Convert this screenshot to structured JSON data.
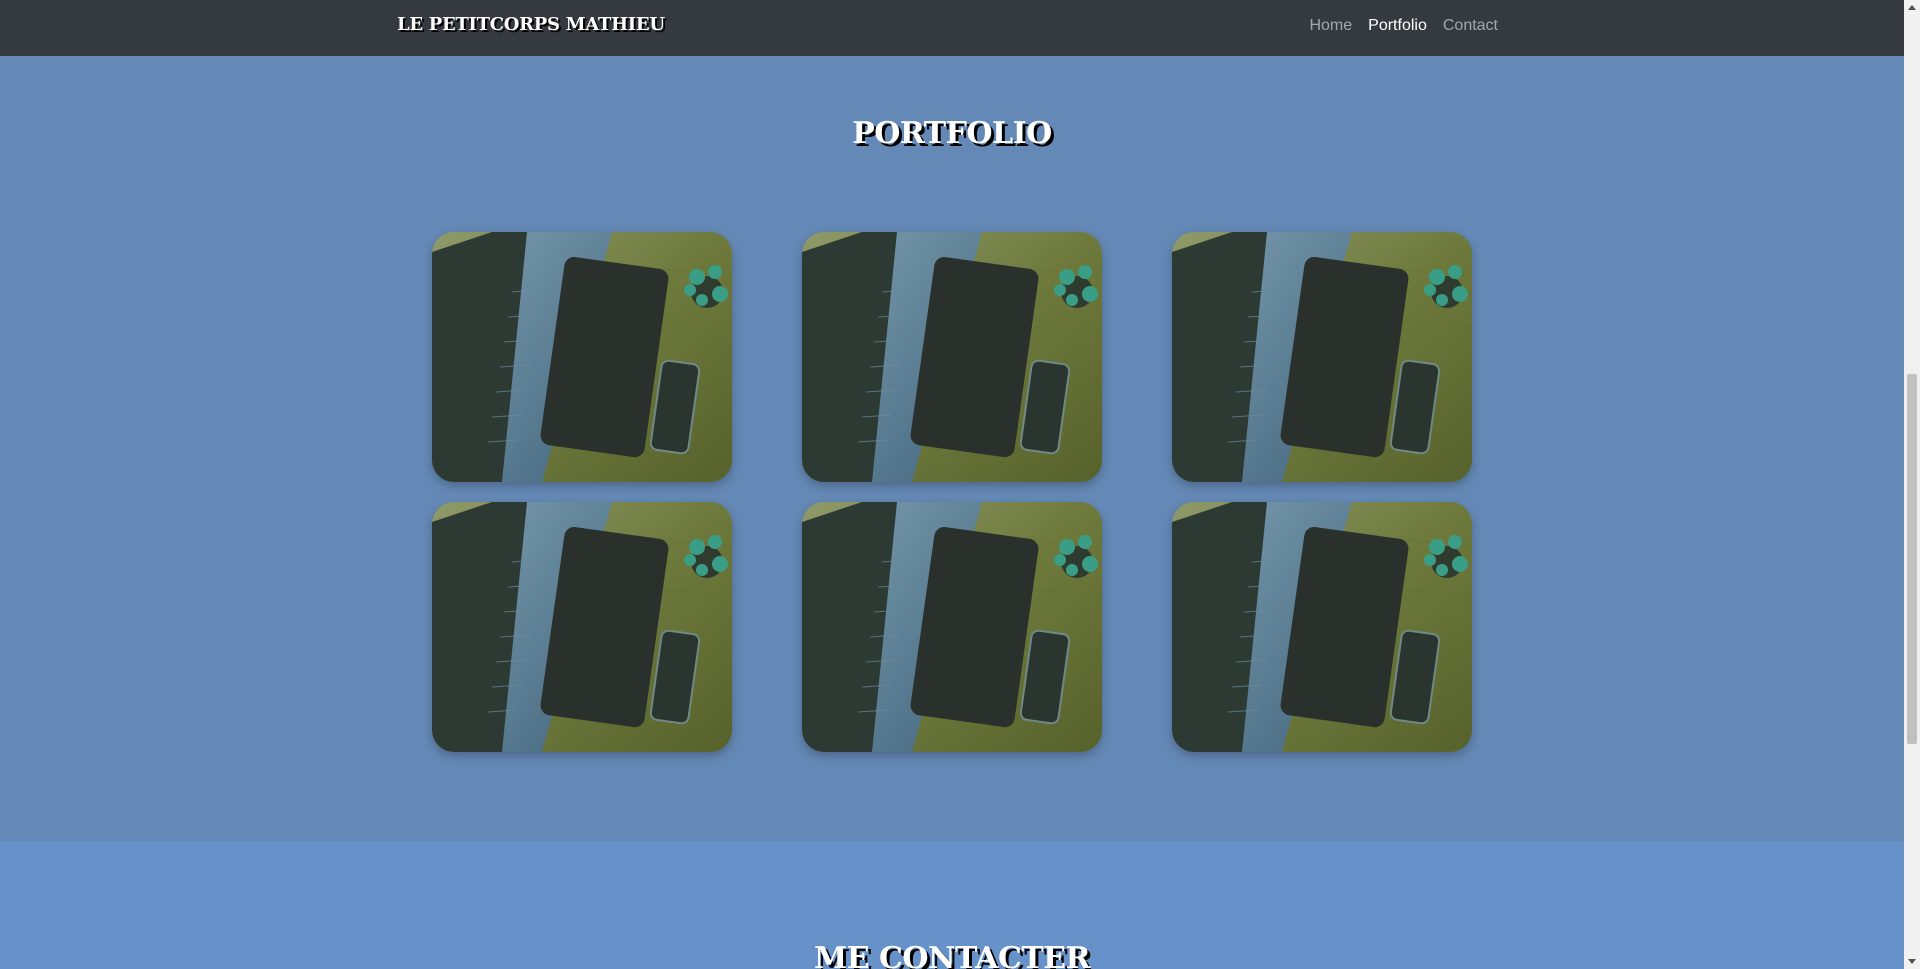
{
  "nav": {
    "brand": "LE PETITCORPS MATHIEU",
    "links": [
      {
        "label": "Home",
        "active": false
      },
      {
        "label": "Portfolio",
        "active": true
      },
      {
        "label": "Contact",
        "active": false
      }
    ]
  },
  "portfolio": {
    "title": "PORTFOLIO",
    "items": [
      {
        "image": "laptop-tablet-phone-desk-photo"
      },
      {
        "image": "laptop-tablet-phone-desk-photo"
      },
      {
        "image": "laptop-tablet-phone-desk-photo"
      },
      {
        "image": "laptop-tablet-phone-desk-photo"
      },
      {
        "image": "laptop-tablet-phone-desk-photo"
      },
      {
        "image": "laptop-tablet-phone-desk-photo"
      }
    ]
  },
  "contact": {
    "title": "ME CONTACTER"
  },
  "colors": {
    "navbar": "#343a40",
    "portfolio_bg": "#6589b6",
    "contact_bg": "#6692c9"
  }
}
